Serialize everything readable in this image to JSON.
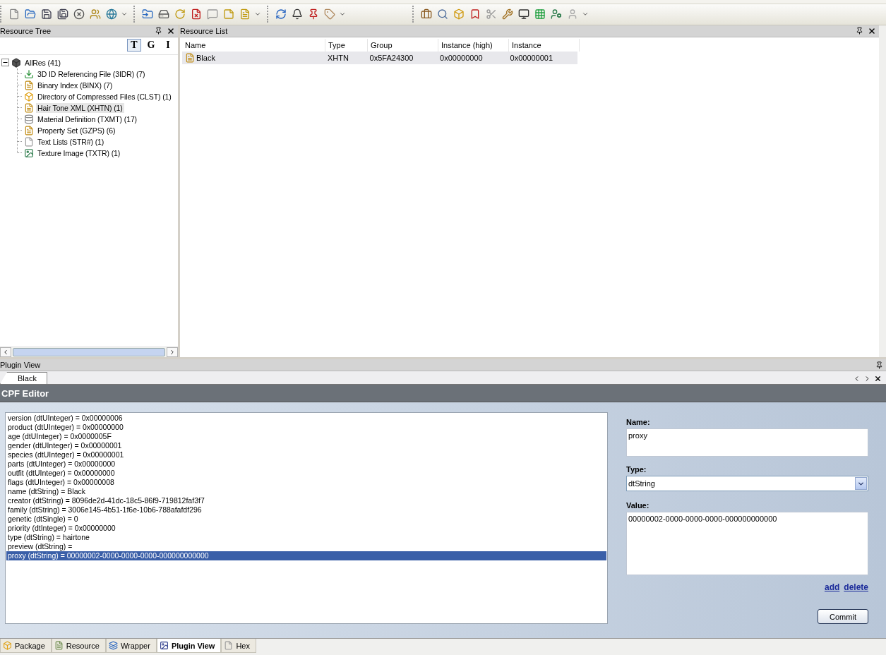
{
  "resource_tree": {
    "title": "Resource Tree",
    "view_buttons": [
      {
        "label": "T",
        "selected": true
      },
      {
        "label": "G",
        "selected": false
      },
      {
        "label": "I",
        "selected": false
      }
    ],
    "root": {
      "label": "AllRes (41)",
      "expanded": true,
      "selected": false,
      "children": [
        {
          "label": "3D ID Referencing File (3IDR) (7)",
          "selected": false
        },
        {
          "label": "Binary Index (BINX) (7)",
          "selected": false
        },
        {
          "label": "Directory of Compressed Files (CLST) (1)",
          "selected": false
        },
        {
          "label": "Hair Tone XML (XHTN) (1)",
          "selected": true
        },
        {
          "label": "Material Definition (TXMT) (17)",
          "selected": false
        },
        {
          "label": "Property Set (GZPS) (6)",
          "selected": false
        },
        {
          "label": "Text Lists (STR#) (1)",
          "selected": false
        },
        {
          "label": "Texture Image (TXTR) (1)",
          "selected": false
        }
      ]
    }
  },
  "resource_list": {
    "title": "Resource List",
    "columns": [
      "Name",
      "Type",
      "Group",
      "Instance (high)",
      "Instance"
    ],
    "rows": [
      {
        "cells": [
          "Black",
          "XHTN",
          "0x5FA24300",
          "0x00000000",
          "0x00000001"
        ],
        "selected": true
      }
    ]
  },
  "plugin_view": {
    "title": "Plugin View",
    "tabs": [
      {
        "label": "Black",
        "selected": true
      }
    ],
    "editor": {
      "title": "CPF Editor",
      "entries": [
        {
          "text": "version (dtUInteger) = 0x00000006",
          "selected": false
        },
        {
          "text": "product (dtUInteger) = 0x00000000",
          "selected": false
        },
        {
          "text": "age (dtUInteger) = 0x0000005F",
          "selected": false
        },
        {
          "text": "gender (dtUInteger) = 0x00000001",
          "selected": false
        },
        {
          "text": "species (dtUInteger) = 0x00000001",
          "selected": false
        },
        {
          "text": "parts (dtUInteger) = 0x00000000",
          "selected": false
        },
        {
          "text": "outfit (dtUInteger) = 0x00000000",
          "selected": false
        },
        {
          "text": "flags (dtUInteger) = 0x00000008",
          "selected": false
        },
        {
          "text": "name (dtString) = Black",
          "selected": false
        },
        {
          "text": "creator (dtString) = 8096de2d-41dc-18c5-86f9-719812faf3f7",
          "selected": false
        },
        {
          "text": "family (dtString) = 3006e145-4b51-1f6e-10b6-788afafdf296",
          "selected": false
        },
        {
          "text": "genetic (dtSingle) = 0",
          "selected": false
        },
        {
          "text": "priority (dtInteger) = 0x00000000",
          "selected": false
        },
        {
          "text": "type (dtString) = hairtone",
          "selected": false
        },
        {
          "text": "preview (dtString) =",
          "selected": false
        },
        {
          "text": "proxy (dtString) = 00000002-0000-0000-0000-000000000000",
          "selected": true
        }
      ],
      "name_label": "Name:",
      "name_value": "proxy",
      "type_label": "Type:",
      "type_value": "dtString",
      "value_label": "Value:",
      "value_value": "00000002-0000-0000-0000-000000000000",
      "links": [
        "add",
        "delete"
      ],
      "commit": "Commit"
    }
  },
  "bottom_tabs": [
    {
      "label": "Package",
      "selected": false
    },
    {
      "label": "Resource",
      "selected": false
    },
    {
      "label": "Wrapper",
      "selected": false
    },
    {
      "label": "Plugin View",
      "selected": true
    },
    {
      "label": "Hex",
      "selected": false
    }
  ]
}
